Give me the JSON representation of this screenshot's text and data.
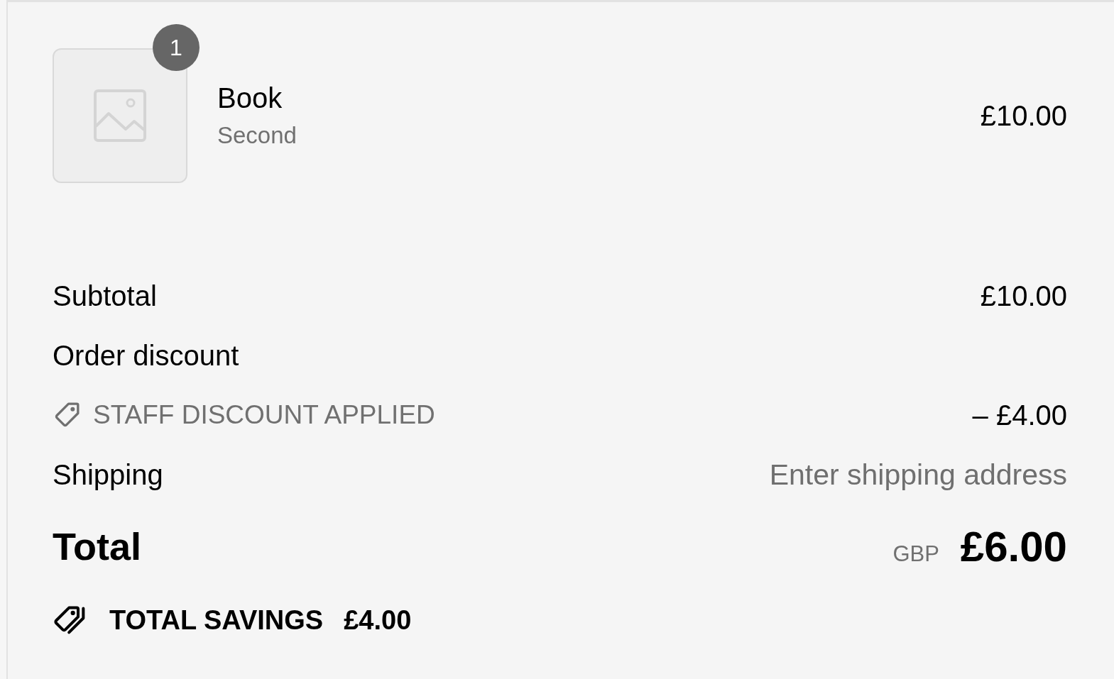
{
  "line_items": [
    {
      "title": "Book",
      "variant": "Second",
      "quantity": "1",
      "price": "£10.00"
    }
  ],
  "summary": [
    {
      "kind": "line",
      "label": "Subtotal",
      "value": "£10.00"
    },
    {
      "kind": "line",
      "label": "Order discount"
    },
    {
      "kind": "discount",
      "label": "STAFF DISCOUNT APPLIED",
      "value": "– £4.00"
    },
    {
      "kind": "pending",
      "label": "Shipping",
      "value": "Enter shipping address"
    }
  ],
  "total": {
    "label": "Total",
    "currency": "GBP",
    "amount": "£6.00"
  },
  "savings": {
    "label": "TOTAL SAVINGS",
    "amount": "£4.00"
  }
}
